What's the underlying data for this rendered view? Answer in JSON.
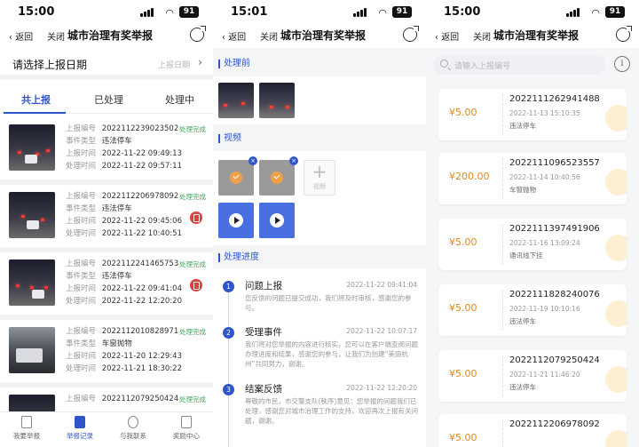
{
  "screens": [
    {
      "status": {
        "time": "15:00",
        "battery": "91"
      },
      "nav": {
        "back": "返回",
        "close": "关闭",
        "title": "城市治理有奖举报"
      },
      "date_filter": {
        "label": "请选择上报日期",
        "placeholder": "上报日期"
      },
      "tabs": [
        "共上报",
        "已处理",
        "处理中"
      ],
      "field_labels": {
        "report_no": "上报编号",
        "event_type": "事件类型",
        "report_time": "上报时间",
        "handle_time": "处理时间"
      },
      "reports": [
        {
          "no": "2022112239023502",
          "type": "违法停车",
          "report_time": "2022-11-22 09:49:13",
          "handle_time": "2022-11-22 09:57:11",
          "status": "处理完成"
        },
        {
          "no": "2022112206978092",
          "type": "违法停车",
          "report_time": "2022-11-22 09:45:06",
          "handle_time": "2022-11-22 10:40:51",
          "status": "处理完成"
        },
        {
          "no": "2022112241465753",
          "type": "违法停车",
          "report_time": "2022-11-22 09:41:04",
          "handle_time": "2022-11-22 12:20:20",
          "status": "处理完成"
        },
        {
          "no": "2022112010828971",
          "type": "车窗抛物",
          "report_time": "2022-11-20 12:29:43",
          "handle_time": "2022-11-21 18:30:22",
          "status": "处理完成"
        },
        {
          "no": "2022112079250424",
          "type": "",
          "report_time": "",
          "handle_time": "",
          "status": "处理完成"
        }
      ],
      "tabbar": [
        "我要举报",
        "举报记录",
        "与我联系",
        "奖励中心"
      ]
    },
    {
      "status": {
        "time": "15:01",
        "battery": "91"
      },
      "nav": {
        "back": "返回",
        "close": "关闭",
        "title": "城市治理有奖举报"
      },
      "section_before": "处理前",
      "section_video": "视频",
      "video_add_label": "视频",
      "section_progress": "处理进度",
      "progress": [
        {
          "step": "1",
          "title": "问题上报",
          "time": "2022-11-22 09:41:04",
          "desc": "您反馈的问题已提交成功，我们将及时审核，感谢您的参与。"
        },
        {
          "step": "2",
          "title": "受理事件",
          "time": "2022-11-22 10:07:17",
          "desc": "我们将对您举报的内容进行核实，您可以在客户端查阅问题办理进度和结果，感谢您的参与，让我们为创建“美丽杭州”共同努力，谢谢。"
        },
        {
          "step": "3",
          "title": "结案反馈",
          "time": "2022-11-22 12:20:20",
          "desc": "尊敬的市民，市交警支队(秩序)意见：您举报的问题我们已处理，感谢您对城市治理工作的支持，欢迎再次上报有关问题，谢谢。"
        }
      ]
    },
    {
      "status": {
        "time": "15:00",
        "battery": "91"
      },
      "nav": {
        "back": "返回",
        "close": "关闭",
        "title": "城市治理有奖举报"
      },
      "search_placeholder": "请输入上报编号",
      "rewards": [
        {
          "amount": "¥5.00",
          "no": "2022111262941488",
          "date": "2022-11-13 15:10:35",
          "type": "违法停车"
        },
        {
          "amount": "¥200.00",
          "no": "2022111096523557",
          "date": "2022-11-14 10:40:56",
          "type": "车窗抛物"
        },
        {
          "amount": "¥5.00",
          "no": "2022111397491906",
          "date": "2022-11-16 13:09:24",
          "type": "通讯线下挂"
        },
        {
          "amount": "¥5.00",
          "no": "2022111828240076",
          "date": "2022-11-19 10:10:16",
          "type": "违法停车"
        },
        {
          "amount": "¥5.00",
          "no": "2022112079250424",
          "date": "2022-11-21 11:46:20",
          "type": "违法停车"
        },
        {
          "amount": "¥5.00",
          "no": "2022112206978092",
          "date": "",
          "type": ""
        }
      ]
    }
  ]
}
